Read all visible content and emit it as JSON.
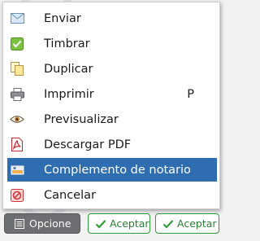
{
  "menu": {
    "items": [
      {
        "label": "Enviar",
        "icon": "envelope-icon",
        "shortcut": ""
      },
      {
        "label": "Timbrar",
        "icon": "checkbox-icon",
        "shortcut": ""
      },
      {
        "label": "Duplicar",
        "icon": "duplicate-icon",
        "shortcut": ""
      },
      {
        "label": "Imprimir",
        "icon": "printer-icon",
        "shortcut": "P"
      },
      {
        "label": "Previsualizar",
        "icon": "eye-icon",
        "shortcut": ""
      },
      {
        "label": "Descargar PDF",
        "icon": "pdf-icon",
        "shortcut": ""
      },
      {
        "label": "Complemento de notario",
        "icon": "id-card-icon",
        "shortcut": "",
        "highlighted": true
      },
      {
        "label": "Cancelar",
        "icon": "cancel-icon",
        "shortcut": ""
      }
    ]
  },
  "footer": {
    "options_label": "Opcione",
    "accept_label_1": "Aceptar",
    "accept_label_2": "Aceptar"
  },
  "colors": {
    "highlight": "#2f6db1",
    "options_button": "#6d6f73",
    "accept_border": "#2e9e3a"
  }
}
